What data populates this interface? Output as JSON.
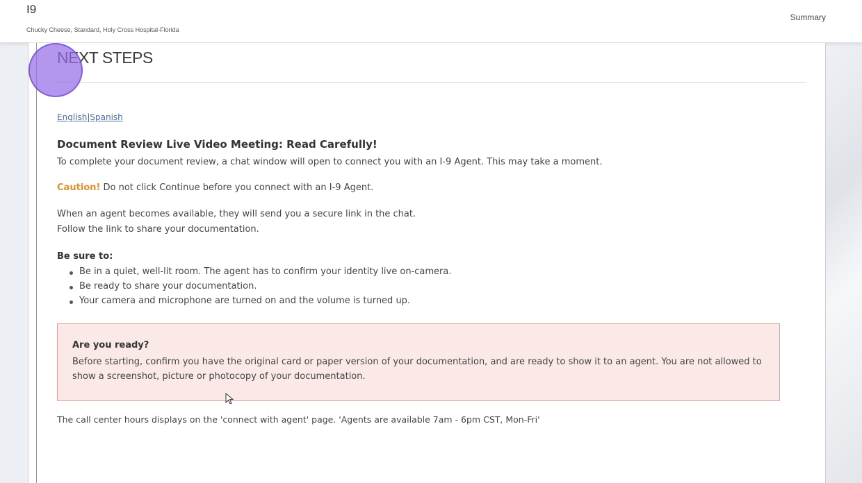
{
  "header": {
    "title": "I9",
    "subtitle": "Chucky Cheese, Standard, Holy Cross Hospital-Florida",
    "summary_link": "Summary"
  },
  "section": {
    "title": "NEXT STEPS"
  },
  "language": {
    "english": "English",
    "separator": "|",
    "spanish": "Spanish"
  },
  "content": {
    "heading": "Document Review Live Video Meeting: Read Carefully!",
    "intro": "To complete your document review, a chat window will open to connect you with an I-9 Agent. This may take a moment.",
    "caution_label": "Caution!",
    "caution_text": " Do not click Continue before you connect with an I-9 Agent.",
    "agent_line1": "When an agent becomes available, they will send you a secure link in the chat.",
    "agent_line2": "Follow the link to share your documentation.",
    "be_sure_label": "Be sure to:",
    "bullets": [
      "Be in a quiet, well-lit room. The agent has to confirm your identity live on-camera.",
      "Be ready to share your documentation.",
      "Your camera and microphone are turned on and the volume is turned up."
    ]
  },
  "alert": {
    "title": "Are you ready?",
    "body": "Before starting, confirm you have the original card or paper version of your documentation, and are ready to show it to an agent. You are not allowed to show a screenshot, picture or photocopy of your documentation."
  },
  "footer": {
    "hours_text": "The call center hours displays on the 'connect with agent' page. 'Agents are available 7am - 6pm CST, Mon-Fri'"
  },
  "colors": {
    "caution": "#e0902a",
    "alert_bg": "#fbe9e8",
    "alert_border": "#e4a19c",
    "link": "#4a6fa5",
    "click_indicator": "#966ee6"
  }
}
